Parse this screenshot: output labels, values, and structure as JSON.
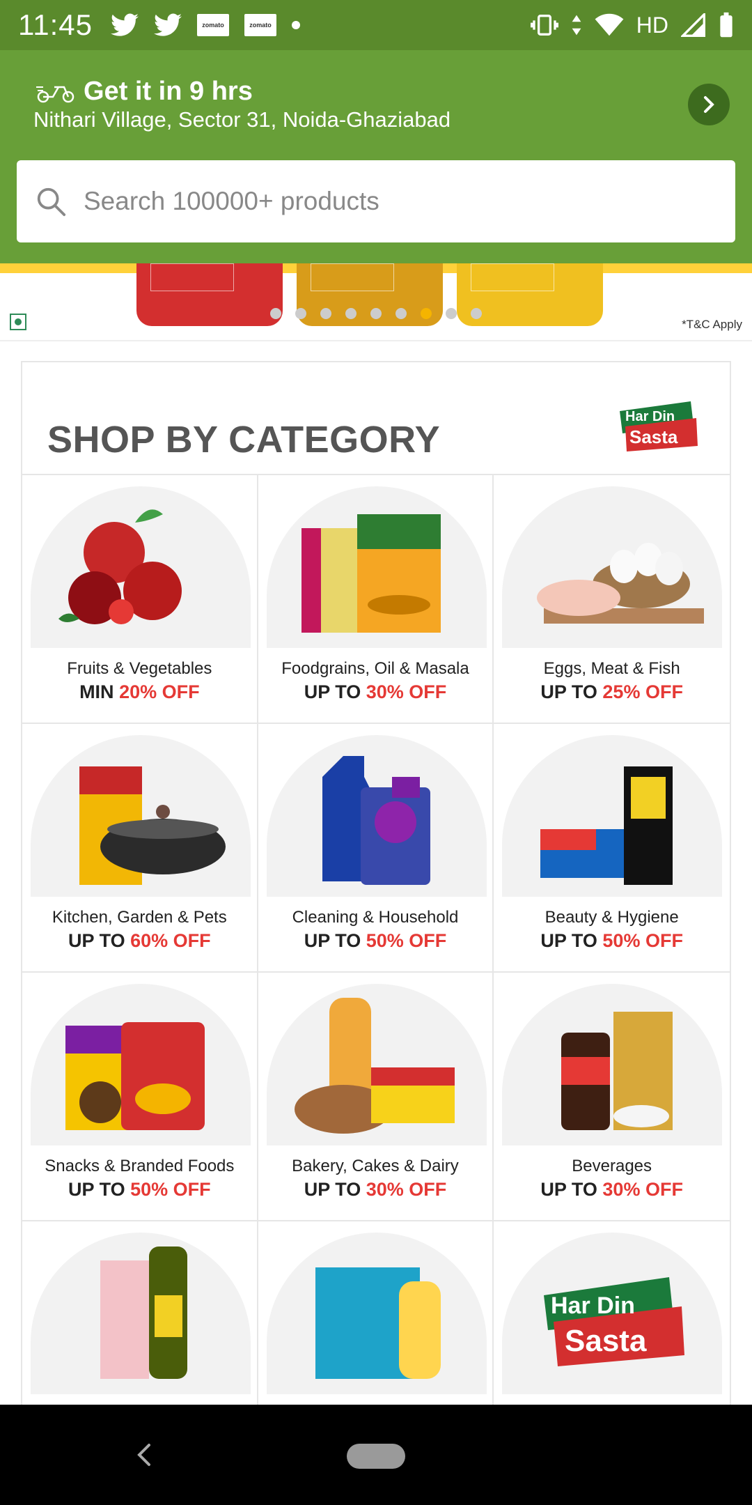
{
  "status_bar": {
    "time": "11:45",
    "left_icons": [
      "twitter-icon",
      "twitter-icon",
      "zomato",
      "zomato",
      "dot"
    ],
    "zomato_label": "zomato",
    "network": "HD"
  },
  "header": {
    "delivery_title": "Get it in 9 hrs",
    "address": "Nithari Village, Sector 31, Noida-Ghaziabad"
  },
  "search": {
    "placeholder": "Search 100000+ products"
  },
  "banner": {
    "tnc": "*T&C Apply",
    "pager_total": 9,
    "pager_active_index": 6
  },
  "category": {
    "title": "SHOP BY CATEGORY",
    "logo_text": [
      "Har Din",
      "Sasta"
    ],
    "items": [
      {
        "name": "Fruits & Vegetables",
        "prefix": "MIN ",
        "discount": "20% OFF"
      },
      {
        "name": "Foodgrains, Oil & Masala",
        "prefix": "UP TO ",
        "discount": "30% OFF"
      },
      {
        "name": "Eggs, Meat & Fish",
        "prefix": "UP TO ",
        "discount": "25% OFF"
      },
      {
        "name": "Kitchen, Garden & Pets",
        "prefix": "UP TO ",
        "discount": "60% OFF"
      },
      {
        "name": "Cleaning & Household",
        "prefix": "UP TO ",
        "discount": "50% OFF"
      },
      {
        "name": "Beauty & Hygiene",
        "prefix": "UP TO ",
        "discount": "50% OFF"
      },
      {
        "name": "Snacks & Branded Foods",
        "prefix": "UP TO ",
        "discount": "50% OFF"
      },
      {
        "name": "Bakery, Cakes & Dairy",
        "prefix": "UP TO ",
        "discount": "30% OFF"
      },
      {
        "name": "Beverages",
        "prefix": "UP TO ",
        "discount": "30% OFF"
      },
      {
        "name": "",
        "prefix": "",
        "discount": ""
      },
      {
        "name": "",
        "prefix": "",
        "discount": ""
      },
      {
        "name": "",
        "prefix": "",
        "discount": ""
      }
    ]
  },
  "colors": {
    "status_bar": "#5a8a2c",
    "header": "#689f38",
    "offer_red": "#e53935",
    "pager_active": "#f5b400"
  }
}
